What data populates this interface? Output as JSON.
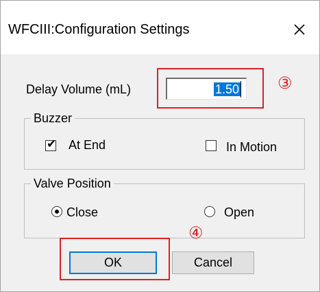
{
  "window": {
    "title": "WFCIII:Configuration Settings",
    "close_glyph": "✕"
  },
  "delay_volume": {
    "label": "Delay Volume (mL)",
    "value": "1.50"
  },
  "buzzer": {
    "group_title": "Buzzer",
    "at_end": {
      "label": "At End",
      "checked": true
    },
    "in_motion": {
      "label": "In Motion",
      "checked": false
    }
  },
  "valve_position": {
    "group_title": "Valve Position",
    "close": {
      "label": "Close",
      "selected": true
    },
    "open": {
      "label": "Open",
      "selected": false
    }
  },
  "buttons": {
    "ok_label": "OK",
    "cancel_label": "Cancel"
  },
  "annotations": {
    "marker_3": "③",
    "marker_4": "④",
    "color": "#e02020"
  },
  "colors": {
    "selection": "#0078d7",
    "dialog_background": "#f0f0f0"
  }
}
